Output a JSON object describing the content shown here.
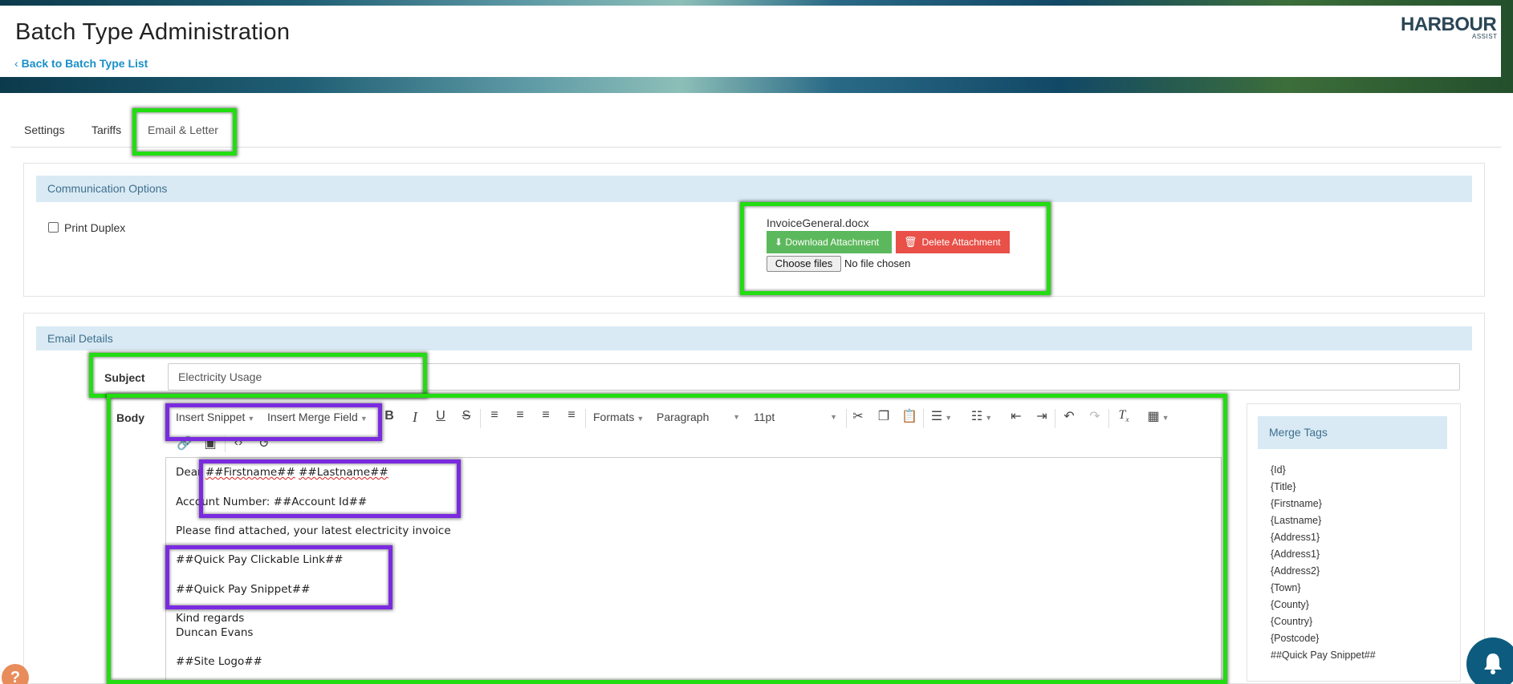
{
  "header": {
    "title": "Batch Type Administration",
    "back_link": "Back to Batch Type List",
    "logo_main": "HARBOUR",
    "logo_sub": "ASSIST"
  },
  "tabs": [
    {
      "label": "Settings"
    },
    {
      "label": "Tariffs"
    },
    {
      "label": "Email & Letter",
      "active": true
    }
  ],
  "communication": {
    "heading": "Communication Options",
    "print_duplex_label": "Print Duplex",
    "print_duplex_checked": false,
    "attachment_name": "InvoiceGeneral.docx",
    "download_label": "Download Attachment",
    "delete_label": "Delete Attachment",
    "choose_files_label": "Choose files",
    "no_file_label": "No file chosen"
  },
  "email": {
    "heading": "Email Details",
    "subject_label": "Subject",
    "subject_value": "Electricity Usage",
    "body_label": "Body",
    "toolbar": {
      "insert_snippet": "Insert Snippet",
      "insert_merge_field": "Insert Merge Field",
      "formats": "Formats",
      "paragraph": "Paragraph",
      "font_size": "11pt"
    },
    "body_lines": {
      "dear": "Dear ",
      "firstname": "##Firstname##",
      "space": " ",
      "lastname": "##Lastname##",
      "account": "Account Number: ##Account Id##",
      "please": "Please find attached, your latest electricity invoice",
      "quick_link": "##Quick Pay Clickable Link##",
      "quick_snippet": "##Quick Pay Snippet##",
      "kind": "Kind regards",
      "name": "Duncan Evans",
      "logo": "##Site Logo##"
    }
  },
  "merge_tags": {
    "heading": "Merge Tags",
    "items": [
      "{Id}",
      "{Title}",
      "{Firstname}",
      "{Lastname}",
      "{Address1}",
      "{Address1}",
      "{Address2}",
      "{Town}",
      "{County}",
      "{Country}",
      "{Postcode}",
      "##Quick Pay Snippet##"
    ]
  },
  "colors": {
    "link": "#1a8fc9",
    "success": "#5cb85c",
    "danger": "#e85048",
    "section_header": "#d9eaf4",
    "highlight_green": "#22dd11",
    "highlight_purple": "#7a2be0"
  },
  "help": {
    "glyph": "?"
  }
}
